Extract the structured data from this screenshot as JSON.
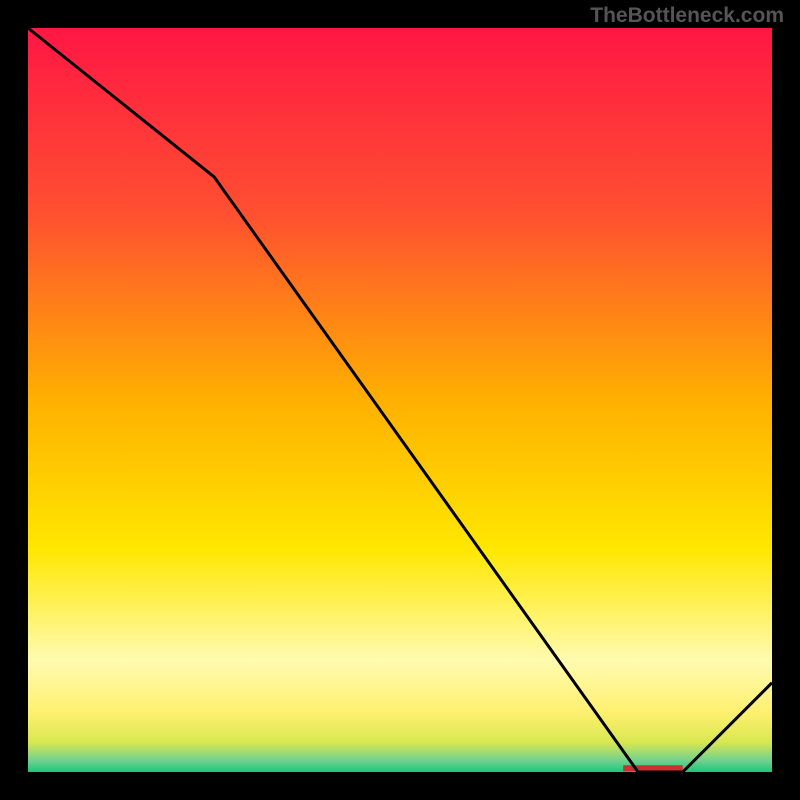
{
  "watermark": "TheBottleneck.com",
  "chart_data": {
    "type": "line",
    "title": "",
    "xlabel": "",
    "ylabel": "",
    "xlim": [
      0,
      100
    ],
    "ylim": [
      0,
      100
    ],
    "x": [
      0,
      25,
      82,
      88,
      100
    ],
    "values": [
      100,
      80,
      0,
      0,
      12
    ],
    "background_gradient": {
      "type": "vertical",
      "stops": [
        {
          "pos": 0.0,
          "color": "#ff1744"
        },
        {
          "pos": 0.25,
          "color": "#ff5030"
        },
        {
          "pos": 0.5,
          "color": "#ffb000"
        },
        {
          "pos": 0.7,
          "color": "#ffe700"
        },
        {
          "pos": 0.85,
          "color": "#fffbb0"
        },
        {
          "pos": 0.92,
          "color": "#fff070"
        },
        {
          "pos": 0.96,
          "color": "#d8e850"
        },
        {
          "pos": 0.985,
          "color": "#70d090"
        },
        {
          "pos": 1.0,
          "color": "#18c878"
        }
      ]
    },
    "marker": {
      "x_start": 80,
      "x_end": 88,
      "y": 0.5,
      "color": "#cc3030"
    }
  }
}
